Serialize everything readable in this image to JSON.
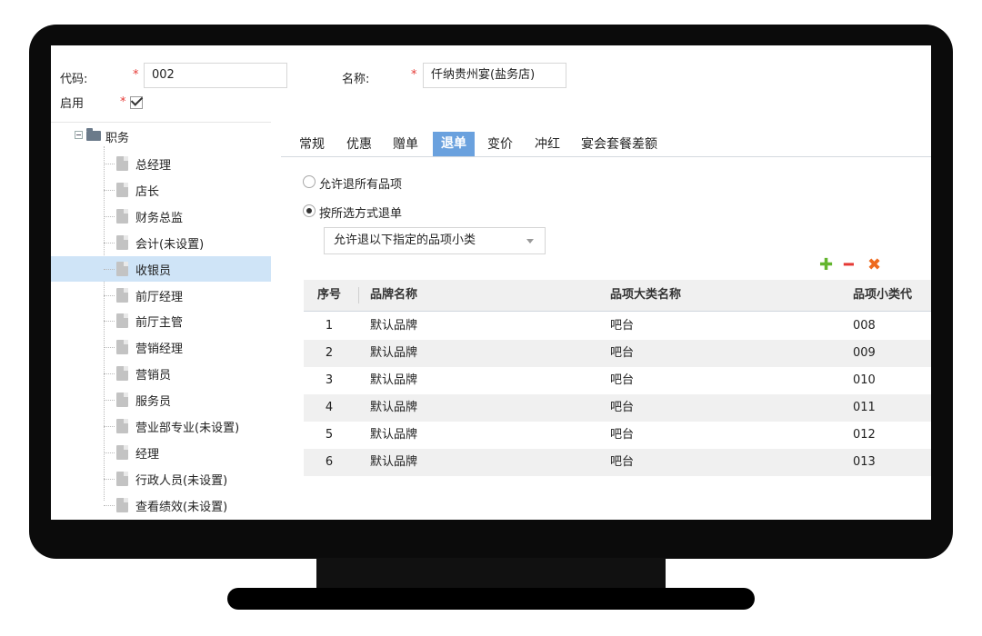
{
  "form": {
    "code_label": "代码:",
    "code_value": "002",
    "name_label": "名称:",
    "name_value": "仟纳贵州宴(盐务店)",
    "enabled_label": "启用",
    "required_mark": "*",
    "enabled_checked": true
  },
  "tree": {
    "root": "职务",
    "items": [
      {
        "label": "总经理"
      },
      {
        "label": "店长"
      },
      {
        "label": "财务总监"
      },
      {
        "label": "会计(未设置)"
      },
      {
        "label": "收银员",
        "selected": true
      },
      {
        "label": "前厅经理"
      },
      {
        "label": "前厅主管"
      },
      {
        "label": "营销经理"
      },
      {
        "label": "营销员"
      },
      {
        "label": "服务员"
      },
      {
        "label": "营业部专业(未设置)"
      },
      {
        "label": "经理"
      },
      {
        "label": "行政人员(未设置)"
      },
      {
        "label": "查看绩效(未设置)"
      }
    ]
  },
  "tabs": [
    {
      "label": "常规"
    },
    {
      "label": "优惠"
    },
    {
      "label": "赠单"
    },
    {
      "label": "退单",
      "active": true
    },
    {
      "label": "变价"
    },
    {
      "label": "冲红"
    },
    {
      "label": "宴会套餐差额"
    }
  ],
  "refund": {
    "option_all": "允许退所有品项",
    "option_selected": "按所选方式退单",
    "selected_option": "option_selected",
    "dropdown_value": "允许退以下指定的品项小类"
  },
  "actions": {
    "add_icon": "plus-icon",
    "remove_icon": "minus-icon",
    "delete_icon": "x-icon",
    "add_glyph": "✚",
    "remove_glyph": "━",
    "delete_glyph": "✖"
  },
  "table": {
    "headers": [
      "序号",
      "品牌名称",
      "品项大类名称",
      "品项小类代"
    ],
    "rows": [
      [
        "1",
        "默认品牌",
        "吧台",
        "008"
      ],
      [
        "2",
        "默认品牌",
        "吧台",
        "009"
      ],
      [
        "3",
        "默认品牌",
        "吧台",
        "010"
      ],
      [
        "4",
        "默认品牌",
        "吧台",
        "011"
      ],
      [
        "5",
        "默认品牌",
        "吧台",
        "012"
      ],
      [
        "6",
        "默认品牌",
        "吧台",
        "013"
      ]
    ]
  },
  "colors": {
    "accent": "#6aa1de",
    "selected_row": "#cfe4f7",
    "required": "#e53935",
    "add": "#63b52e",
    "delete": "#ee6a1f"
  }
}
